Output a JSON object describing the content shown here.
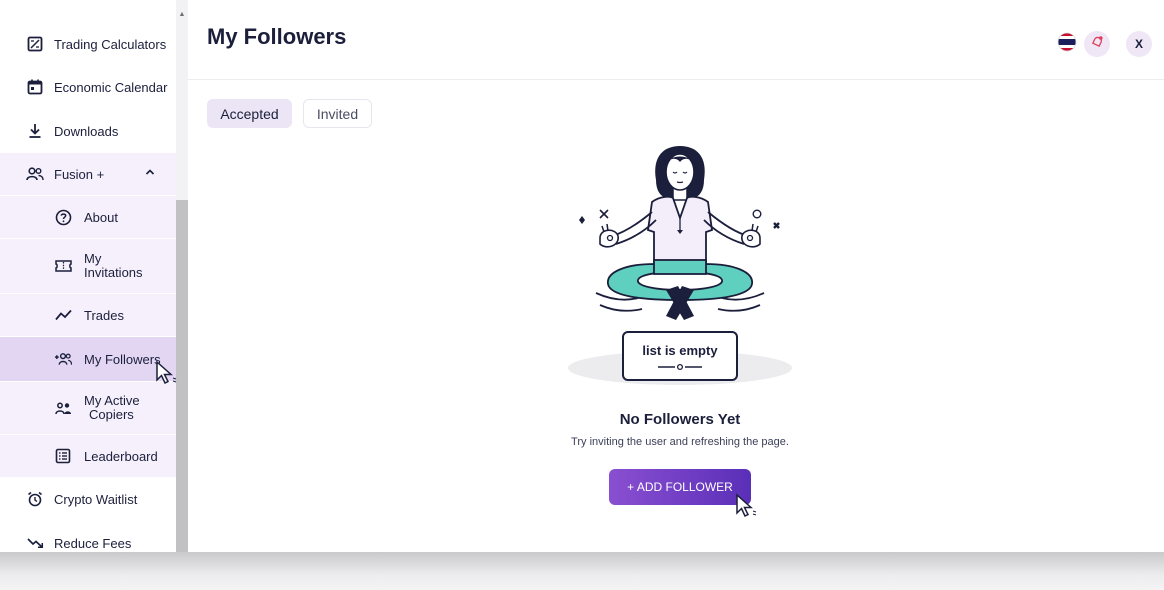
{
  "sidebar": {
    "items": [
      {
        "label": "Trading Calculators",
        "icon": "calculator-icon"
      },
      {
        "label": "Economic Calendar",
        "icon": "calendar-icon"
      },
      {
        "label": "Downloads",
        "icon": "download-icon"
      },
      {
        "label": "Fusion +",
        "icon": "group-icon",
        "expanded": true
      },
      {
        "label": "About",
        "icon": "help-circle-icon"
      },
      {
        "label": "My",
        "label2": "Invitations",
        "icon": "ticket-icon"
      },
      {
        "label": "Trades",
        "icon": "trend-line-icon"
      },
      {
        "label": "My Followers",
        "icon": "add-group-icon",
        "active": true
      },
      {
        "label": "My Active",
        "label2": "Copiers",
        "icon": "copiers-icon"
      },
      {
        "label": "Leaderboard",
        "icon": "list-icon"
      },
      {
        "label": "Crypto Waitlist",
        "icon": "alarm-clock-icon"
      },
      {
        "label": "Reduce Fees",
        "icon": "trend-down-icon"
      }
    ]
  },
  "header": {
    "title": "My Followers",
    "close_label": "X"
  },
  "tabs": [
    {
      "label": "Accepted",
      "active": true
    },
    {
      "label": "Invited",
      "active": false
    }
  ],
  "empty_state": {
    "sign_text": "list is empty",
    "title": "No Followers Yet",
    "description": "Try inviting the user and refreshing the page.",
    "button_label": "+ ADD FOLLOWER"
  },
  "colors": {
    "accent": "#7a44c9",
    "active_item_bg": "#e3d6f3",
    "submenu_bg": "#f5f0fb",
    "text_dark": "#1b1f3b",
    "illustration_teal": "#5fcfbf"
  }
}
